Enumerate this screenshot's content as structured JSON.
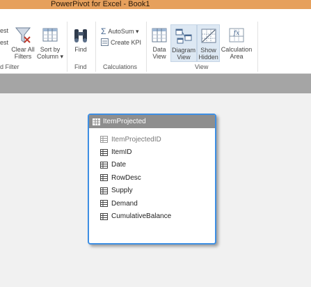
{
  "titlebar": {
    "title": "PowerPivot for Excel - Book1"
  },
  "ribbon": {
    "left_partial": {
      "line1": "est",
      "line2": "est",
      "group_label": "d Filter"
    },
    "clear_all_filters": {
      "line1": "Clear All",
      "line2": "Filters"
    },
    "sort_by_column": {
      "line1": "Sort by",
      "line2": "Column ▾"
    },
    "find": {
      "label": "Find",
      "group_label": "Find"
    },
    "autosum": {
      "label": "AutoSum ▾"
    },
    "create_kpi": {
      "label": "Create KPI"
    },
    "calculations_group_label": "Calculations",
    "data_view": {
      "line1": "Data",
      "line2": "View"
    },
    "diagram_view": {
      "line1": "Diagram",
      "line2": "View"
    },
    "show_hidden": {
      "line1": "Show",
      "line2": "Hidden"
    },
    "calculation_area": {
      "line1": "Calculation",
      "line2": "Area"
    },
    "view_group_label": "View"
  },
  "diagram": {
    "table": {
      "name": "ItemProjected",
      "fields": [
        {
          "name": "ItemProjectedID",
          "hidden": true
        },
        {
          "name": "ItemID",
          "hidden": false
        },
        {
          "name": "Date",
          "hidden": false
        },
        {
          "name": "RowDesc",
          "hidden": false
        },
        {
          "name": "Supply",
          "hidden": false
        },
        {
          "name": "Demand",
          "hidden": false
        },
        {
          "name": "CumulativeBalance",
          "hidden": false
        }
      ]
    }
  },
  "colors": {
    "titlebar": "#e6a05c",
    "card_border": "#3d8ee3",
    "card_header": "#8e8e8e",
    "band": "#a5a5a5"
  }
}
